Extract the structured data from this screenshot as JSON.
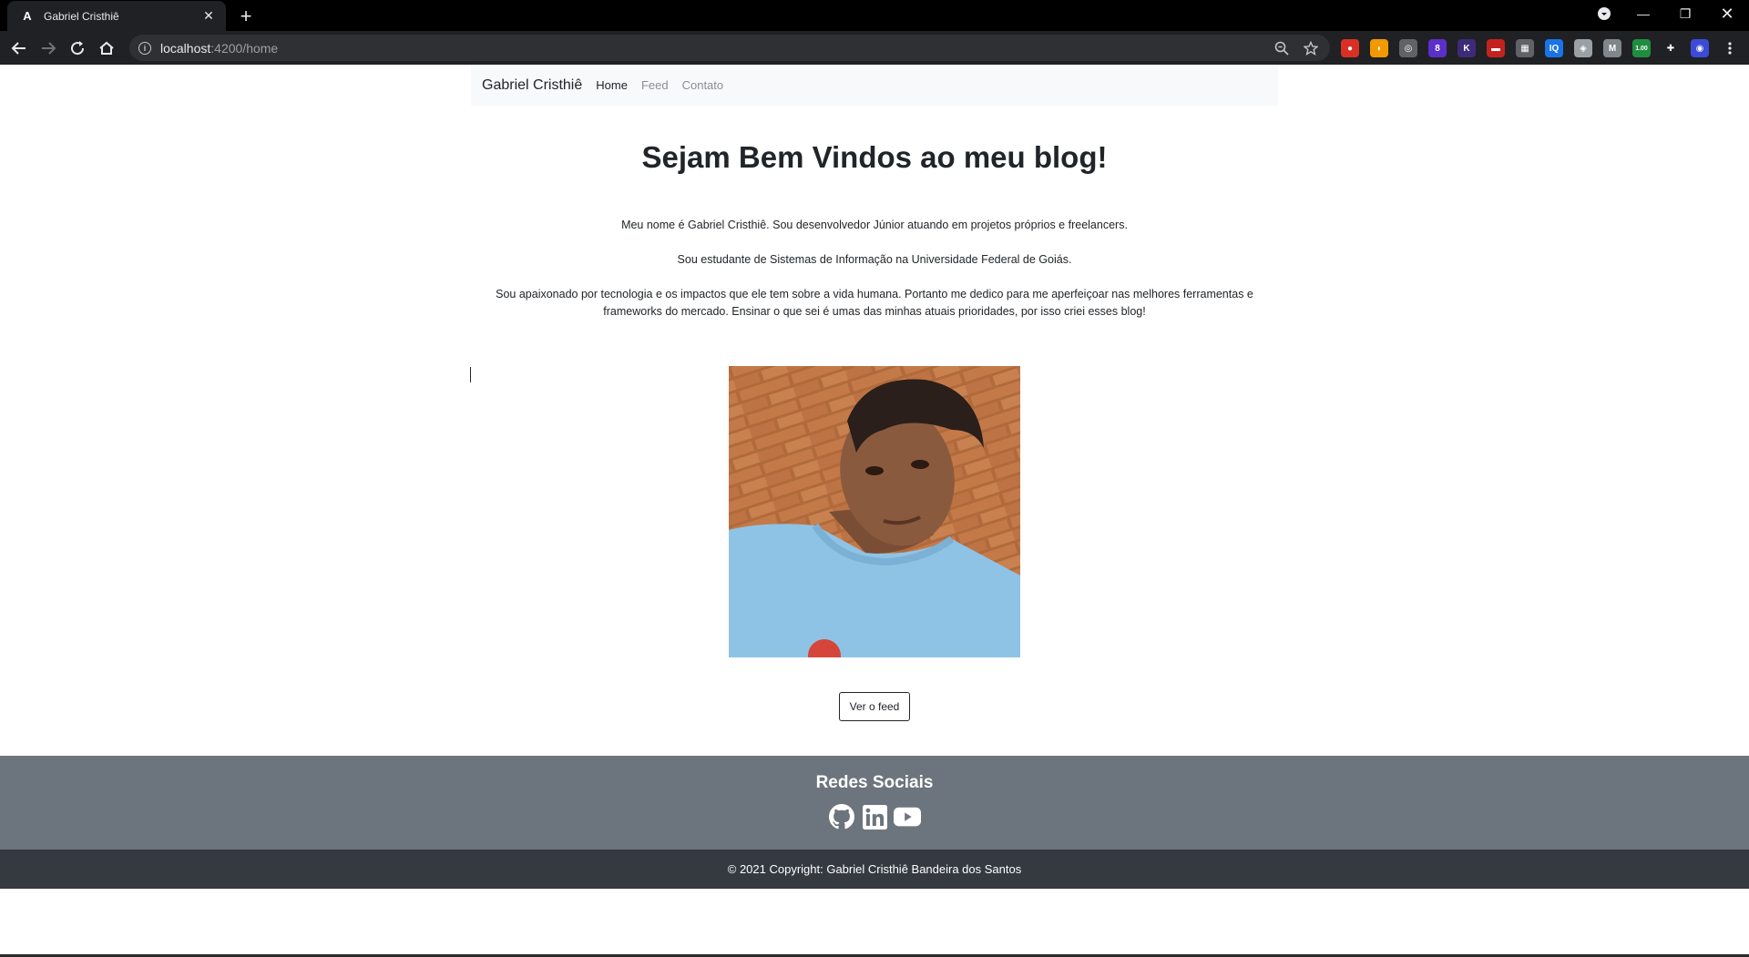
{
  "browser": {
    "tab_title": "Gabriel Cristhiê",
    "tab_favicon": "A",
    "url_host": "localhost",
    "url_rest": ":4200/home",
    "extensions": [
      {
        "icon": "adblock-icon",
        "color": "#d93025",
        "label": "●"
      },
      {
        "icon": "banana-extension-icon",
        "color": "#f29900",
        "label": "◗"
      },
      {
        "icon": "round-extension-icon",
        "color": "#5f6368",
        "label": "◎"
      },
      {
        "icon": "purple-extension-icon",
        "color": "#5b2fc9",
        "label": "8"
      },
      {
        "icon": "k-extension-icon",
        "color": "#3d2a7a",
        "label": "K"
      },
      {
        "icon": "red-extension-icon",
        "color": "#c5221f",
        "label": "▬"
      },
      {
        "icon": "grid-extension-icon",
        "color": "#5f6368",
        "label": "▦"
      },
      {
        "icon": "iq-extension-icon",
        "color": "#1a73e8",
        "label": "IQ"
      },
      {
        "icon": "compass-extension-icon",
        "color": "#9aa0a6",
        "label": "◈"
      },
      {
        "icon": "m-extension-icon",
        "color": "#80868b",
        "label": "M"
      },
      {
        "icon": "speed-extension-icon",
        "color": "#1e8e3e",
        "label": "1.00"
      },
      {
        "icon": "puzzle-icon",
        "color": "#202124",
        "label": "✚"
      },
      {
        "icon": "avatar-icon",
        "color": "#3c4ad8",
        "label": "◉"
      }
    ]
  },
  "navbar": {
    "brand": "Gabriel Cristhiê",
    "links": [
      {
        "label": "Home",
        "active": true
      },
      {
        "label": "Feed",
        "active": false
      },
      {
        "label": "Contato",
        "active": false
      }
    ]
  },
  "hero": {
    "title": "Sejam Bem Vindos ao meu blog!",
    "paragraphs": [
      "Meu nome é Gabriel Cristhiê. Sou desenvolvedor Júnior atuando em projetos próprios e freelancers.",
      "Sou estudante de Sistemas de Informação na Universidade Federal de Goiás.",
      "Sou apaixonado por tecnologia e os impactos que ele tem sobre a vida humana. Portanto me dedico para me aperfeiçoar nas melhores ferramentas e frameworks do mercado. Ensinar o que sei é umas das minhas atuais prioridades, por isso criei esses blog!"
    ]
  },
  "actions": {
    "feed_button": "Ver o feed"
  },
  "footer": {
    "social_title": "Redes Sociais",
    "social_icons": [
      "github-icon",
      "linkedin-icon",
      "youtube-icon"
    ],
    "copyright": "© 2021 Copyright: Gabriel Cristhiê Bandeira dos Santos"
  }
}
